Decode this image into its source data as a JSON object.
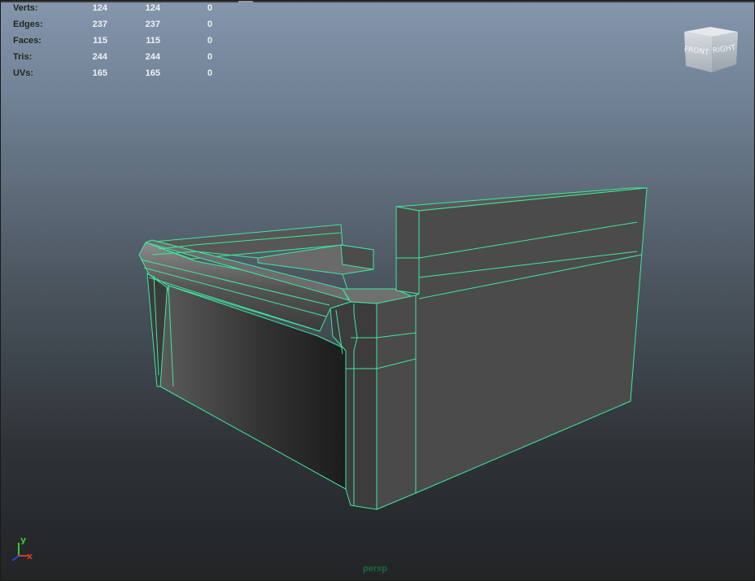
{
  "hud": {
    "rows": [
      {
        "label": "Verts:",
        "v1": "124",
        "v2": "124",
        "v3": "0"
      },
      {
        "label": "Edges:",
        "v1": "237",
        "v2": "237",
        "v3": "0"
      },
      {
        "label": "Faces:",
        "v1": "115",
        "v2": "115",
        "v3": "0"
      },
      {
        "label": "Tris:",
        "v1": "244",
        "v2": "244",
        "v3": "0"
      },
      {
        "label": "UVs:",
        "v1": "165",
        "v2": "165",
        "v3": "0"
      }
    ]
  },
  "viewcube": {
    "front_label": "FRONT",
    "right_label": "RIGHT"
  },
  "axis": {
    "y_label": "y",
    "x_label": "x"
  },
  "camera": {
    "name": "persp"
  },
  "colors": {
    "wireframe": "#3ee8a0",
    "x_axis": "#d23a2a",
    "y_axis": "#3ac43a",
    "z_axis": "#2a44d8"
  }
}
